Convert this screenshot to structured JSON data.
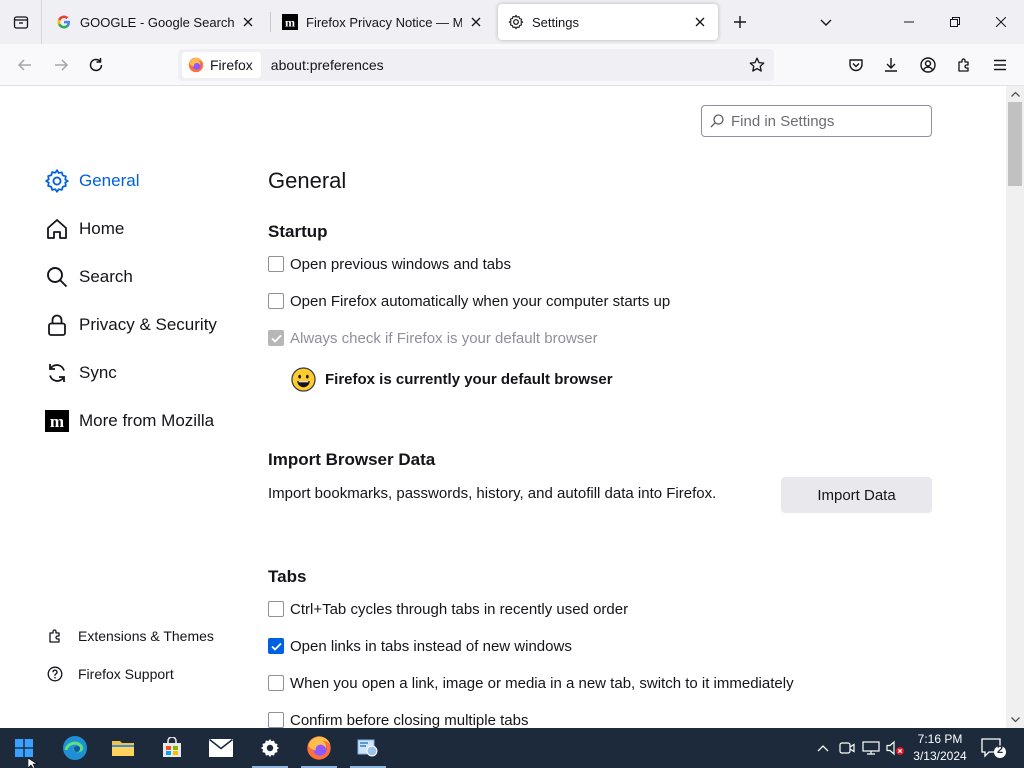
{
  "tabs": [
    {
      "title": "GOOGLE - Google Search",
      "icon": "google-icon"
    },
    {
      "title": "Firefox Privacy Notice — Mozilla",
      "icon": "mozilla-icon"
    },
    {
      "title": "Settings",
      "icon": "gear-icon",
      "active": true
    }
  ],
  "urlbar": {
    "identity_label": "Firefox",
    "url": "about:preferences"
  },
  "search": {
    "placeholder": "Find in Settings"
  },
  "sidebar": {
    "categories": [
      {
        "label": "General",
        "icon": "gear-icon",
        "selected": true
      },
      {
        "label": "Home",
        "icon": "home-icon"
      },
      {
        "label": "Search",
        "icon": "search-icon"
      },
      {
        "label": "Privacy & Security",
        "icon": "lock-icon"
      },
      {
        "label": "Sync",
        "icon": "sync-icon"
      },
      {
        "label": "More from Mozilla",
        "icon": "mozilla-icon"
      }
    ],
    "footer": [
      {
        "label": "Extensions & Themes",
        "icon": "puzzle-icon"
      },
      {
        "label": "Firefox Support",
        "icon": "help-icon"
      }
    ]
  },
  "main": {
    "title": "General",
    "startup": {
      "heading": "Startup",
      "options": [
        {
          "label": "Open previous windows and tabs",
          "checked": false
        },
        {
          "label": "Open Firefox automatically when your computer starts up",
          "checked": false
        },
        {
          "label": "Always check if Firefox is your default browser",
          "checked": true,
          "disabled": true
        }
      ],
      "default_status": "Firefox is currently your default browser"
    },
    "import": {
      "heading": "Import Browser Data",
      "description": "Import bookmarks, passwords, history, and autofill data into Firefox.",
      "button": "Import Data"
    },
    "tabs_section": {
      "heading": "Tabs",
      "options": [
        {
          "label": "Ctrl+Tab cycles through tabs in recently used order",
          "checked": false
        },
        {
          "label": "Open links in tabs instead of new windows",
          "checked": true
        },
        {
          "label": "When you open a link, image or media in a new tab, switch to it immediately",
          "checked": false
        },
        {
          "label": "Confirm before closing multiple tabs",
          "checked": false
        }
      ]
    }
  },
  "taskbar": {
    "time": "7:16 PM",
    "date": "3/13/2024",
    "notification_count": "2"
  },
  "colors": {
    "accent": "#0061e0",
    "taskbar": "#1c2a3c",
    "tabstrip": "#f0f0f4"
  }
}
